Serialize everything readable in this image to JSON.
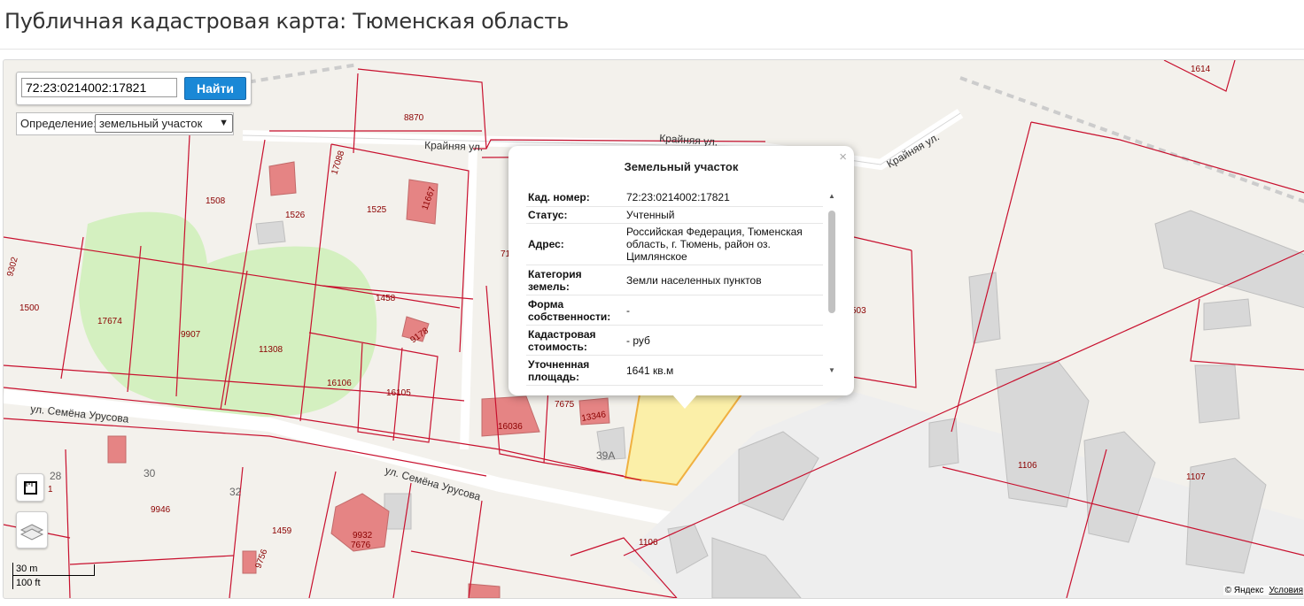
{
  "page": {
    "title": "Публичная кадастровая карта: Тюменская область"
  },
  "search": {
    "value": "72:23:0214002:17821",
    "button_label": "Найти"
  },
  "definition": {
    "label": "Определение:",
    "selected": "земельный участок"
  },
  "popup": {
    "title": "Земельный участок",
    "close_symbol": "×",
    "rows": [
      {
        "key": "Кад. номер:",
        "value": "72:23:0214002:17821"
      },
      {
        "key": "Статус:",
        "value": "Учтенный"
      },
      {
        "key": "Адрес:",
        "value": "Российская Федерация, Тюменская область, г. Тюмень, район оз. Цимлянское"
      },
      {
        "key": "Категория земель:",
        "value": "Земли населенных пунктов"
      },
      {
        "key": "Форма собственности:",
        "value": "-"
      },
      {
        "key": "Кадастровая стоимость:",
        "value": "- руб"
      },
      {
        "key": "Уточненная площадь:",
        "value": "1641 кв.м"
      }
    ]
  },
  "map": {
    "streets": {
      "kraynyaya_1": "Крайняя ул.",
      "kraynyaya_2": "Крайняя ул.",
      "kraynyaya_3": "Крайняя ул.",
      "semena_1": "ул. Семёна Урусова",
      "semena_2": "ул. Семёна Урусова"
    },
    "plots": [
      "8870",
      "1614",
      "1508",
      "1526",
      "17088",
      "1525",
      "11667",
      "1500",
      "9302",
      "17674",
      "9907",
      "11308",
      "1458",
      "9178",
      "16106",
      "16105",
      "16036",
      "7675",
      "13346",
      "1106",
      "1106",
      "1107",
      "9946",
      "1459",
      "9756",
      "9932",
      "7676",
      "503",
      "71",
      "1"
    ],
    "house_numbers": [
      "28",
      "30",
      "32",
      "39А"
    ],
    "colors": {
      "boundary": "#c8102e",
      "green": "#d4f0c0",
      "building": "#e58484",
      "selected": "#fbefa8"
    }
  },
  "scale": {
    "metric": "30 m",
    "imperial": "100 ft"
  },
  "copyright": {
    "text": "© Яндекс",
    "link": "Условия"
  }
}
